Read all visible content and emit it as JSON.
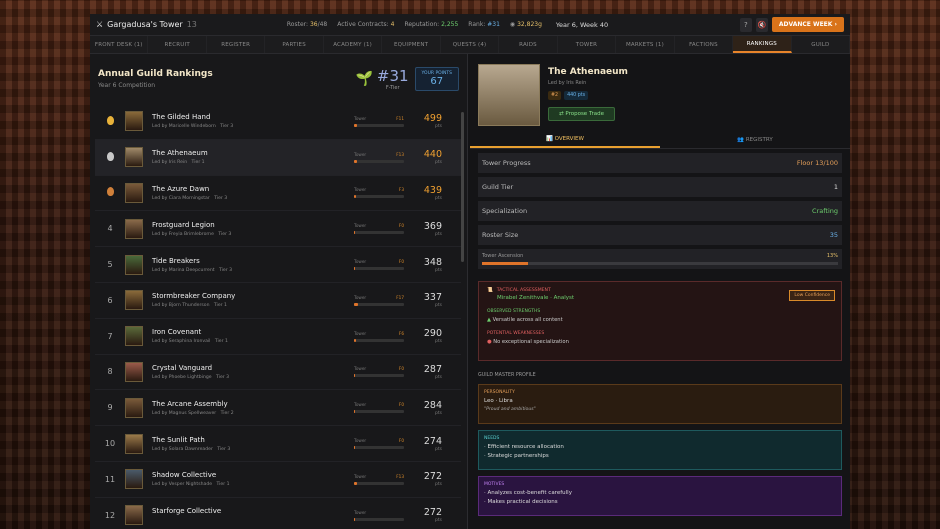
{
  "topbar": {
    "title": "Gargadusa's Tower",
    "title_sub": "13",
    "roster_label": "Roster:",
    "roster_value": "36",
    "roster_max": "/48",
    "contracts_label": "Active Contracts:",
    "contracts_value": "4",
    "reputation_label": "Reputation:",
    "reputation_value": "2,255",
    "rank_label": "Rank:",
    "rank_value": "#31",
    "gold_value": "32,823g",
    "week": "Year 6, Week 40",
    "help_label": "?",
    "advance_label": "ADVANCE WEEK ›"
  },
  "tabs": [
    {
      "label": "FRONT DESK (1)",
      "active": false
    },
    {
      "label": "RECRUIT",
      "active": false
    },
    {
      "label": "REGISTER",
      "active": false
    },
    {
      "label": "PARTIES",
      "active": false
    },
    {
      "label": "ACADEMY (1)",
      "active": false
    },
    {
      "label": "EQUIPMENT",
      "active": false
    },
    {
      "label": "QUESTS (4)",
      "active": false
    },
    {
      "label": "RAIDS",
      "active": false
    },
    {
      "label": "TOWER",
      "active": false
    },
    {
      "label": "MARKETS (1)",
      "active": false
    },
    {
      "label": "FACTIONS",
      "active": false
    },
    {
      "label": "RANKINGS",
      "active": true
    },
    {
      "label": "GUILD",
      "active": false
    }
  ],
  "rankings": {
    "title": "Annual Guild Rankings",
    "subtitle": "Year 6 Competition",
    "my_rank": "#31",
    "my_tier": "F-Tier",
    "points_label": "YOUR POINTS",
    "points_value": "67",
    "tower_label": "Tower",
    "pts_label": "pts",
    "rows": [
      {
        "rank": "",
        "medal": "#e8b23a",
        "name": "The Gilded Hand",
        "leader": "Led by Maricelle Windeborn",
        "tier": "Tier 3",
        "floor": "F11",
        "progress": 0.11,
        "score": "499",
        "score_color": "#f0a030",
        "portrait": "#8a6a3a"
      },
      {
        "rank": "",
        "medal": "#c8c8c8",
        "name": "The Athenaeum",
        "leader": "Led by Iris Rein",
        "tier": "Tier 1",
        "floor": "F13",
        "progress": 0.13,
        "score": "440",
        "score_color": "#f0a030",
        "portrait": "#a08a6a"
      },
      {
        "rank": "",
        "medal": "#d0803a",
        "name": "The Azure Dawn",
        "leader": "Led by Ciara Morningstar",
        "tier": "Tier 3",
        "floor": "F3",
        "progress": 0.03,
        "score": "439",
        "score_color": "#f0a030",
        "portrait": "#7a5a3a"
      },
      {
        "rank": "4",
        "medal": "",
        "name": "Frostguard Legion",
        "leader": "Led by Freyia Brimlebrorne",
        "tier": "Tier 3",
        "floor": "F0",
        "progress": 0.0,
        "score": "369",
        "score_color": "#dddddd",
        "portrait": "#8a6a4a"
      },
      {
        "rank": "5",
        "medal": "",
        "name": "Tide Breakers",
        "leader": "Led by Marina Deepcurrent",
        "tier": "Tier 3",
        "floor": "F0",
        "progress": 0.0,
        "score": "348",
        "score_color": "#dddddd",
        "portrait": "#4a6a3a"
      },
      {
        "rank": "6",
        "medal": "",
        "name": "Stormbreaker Company",
        "leader": "Led by Bjorn Thunderson",
        "tier": "Tier 1",
        "floor": "F17",
        "progress": 0.17,
        "score": "337",
        "score_color": "#dddddd",
        "portrait": "#8a6a3a"
      },
      {
        "rank": "7",
        "medal": "",
        "name": "Iron Covenant",
        "leader": "Led by Seraphina Ironvail",
        "tier": "Tier 1",
        "floor": "F6",
        "progress": 0.06,
        "score": "290",
        "score_color": "#dddddd",
        "portrait": "#5a6a3a"
      },
      {
        "rank": "8",
        "medal": "",
        "name": "Crystal Vanguard",
        "leader": "Led by Phoebe Lightbinge",
        "tier": "Tier 3",
        "floor": "F0",
        "progress": 0.0,
        "score": "287",
        "score_color": "#dddddd",
        "portrait": "#9a5a4a"
      },
      {
        "rank": "9",
        "medal": "",
        "name": "The Arcane Assembly",
        "leader": "Led by Magnus Spellweaver",
        "tier": "Tier 2",
        "floor": "F0",
        "progress": 0.0,
        "score": "284",
        "score_color": "#dddddd",
        "portrait": "#7a5a3a"
      },
      {
        "rank": "10",
        "medal": "",
        "name": "The Sunlit Path",
        "leader": "Led by Solara Dawnreader",
        "tier": "Tier 3",
        "floor": "F0",
        "progress": 0.0,
        "score": "274",
        "score_color": "#dddddd",
        "portrait": "#9a7a4a"
      },
      {
        "rank": "11",
        "medal": "",
        "name": "Shadow Collective",
        "leader": "Led by Vesper Nightshade",
        "tier": "Tier 1",
        "floor": "F13",
        "progress": 0.13,
        "score": "272",
        "score_color": "#dddddd",
        "portrait": "#4a5a6a"
      },
      {
        "rank": "12",
        "medal": "",
        "name": "Starforge Collective",
        "leader": "",
        "tier": "",
        "floor": "",
        "progress": 0.0,
        "score": "272",
        "score_color": "#dddddd",
        "portrait": "#8a6a4a"
      }
    ]
  },
  "detail": {
    "name": "The Athenaeum",
    "leader": "Led by Iris Rein",
    "badge_rank": "#2",
    "badge_pts": "440 pts",
    "trade_label": "Propose Trade",
    "tab_overview": "OVERVIEW",
    "tab_registry": "REGISTRY",
    "stats": [
      {
        "label": "Tower Progress",
        "value": "Floor 13/100",
        "color": "#e6a05a"
      },
      {
        "label": "Guild Tier",
        "value": "1",
        "color": "#dddddd"
      },
      {
        "label": "Specialization",
        "value": "Crafting",
        "color": "#6ecf6e"
      },
      {
        "label": "Roster Size",
        "value": "35",
        "color": "#6ab0e6"
      }
    ],
    "ascension_label": "Tower Ascension",
    "ascension_value": "13%",
    "ascension_progress": 0.13,
    "tactical": {
      "header": "TACTICAL ASSESSMENT",
      "by": "Mirabel Zenithvale · Analyst",
      "confidence": "Low Confidence",
      "strengths_label": "OBSERVED STRENGTHS",
      "strength": "Versatile across all content",
      "weaknesses_label": "POTENTIAL WEAKNESSES",
      "weakness": "No exceptional specialization"
    },
    "profile_label": "GUILD MASTER PROFILE",
    "personality_label": "PERSONALITY",
    "personality_sign": "Leo",
    "personality_sign2": "Libra",
    "personality_quote": "\"Proud and ambitious\"",
    "needs_label": "NEEDS",
    "needs": [
      "· Efficient resource allocation",
      "· Strategic partnerships"
    ],
    "motives_label": "MOTIVES",
    "motives": [
      "· Analyzes cost-benefit carefully",
      "· Makes practical decisions"
    ]
  }
}
